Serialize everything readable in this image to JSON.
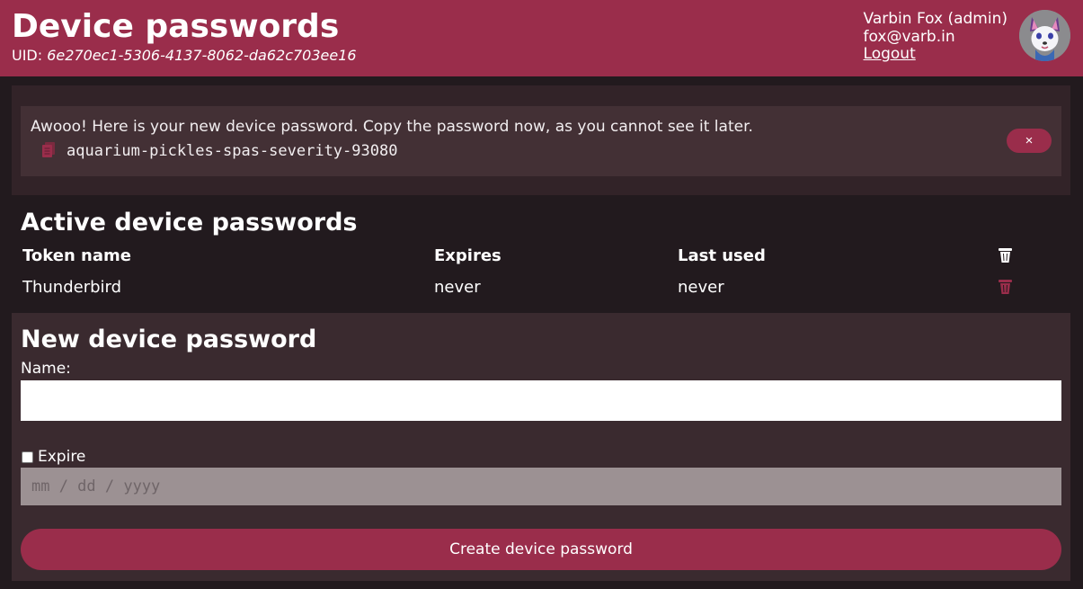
{
  "header": {
    "title": "Device passwords",
    "uid_label": "UID:",
    "uid_value": "6e270ec1-5306-4137-8062-da62c703ee16",
    "user_name": "Varbin Fox (admin)",
    "user_email": "fox@varb.in",
    "logout_label": "Logout"
  },
  "alert": {
    "message": "Awooo! Here is your new device password. Copy the password now, as you cannot see it later.",
    "password": "aquarium-pickles-spas-severity-93080",
    "copy_icon": "copy-icon",
    "close_label": "×"
  },
  "active": {
    "title": "Active device passwords",
    "columns": [
      "Token name",
      "Expires",
      "Last used"
    ],
    "header_icon": "trash-icon",
    "rows": [
      {
        "name": "Thunderbird",
        "expires": "never",
        "last_used": "never",
        "delete_icon": "trash-icon"
      }
    ]
  },
  "form": {
    "title": "New device password",
    "name_label": "Name:",
    "name_value": "",
    "expire_label": "Expire",
    "expire_checked": false,
    "date_placeholder": "mm / dd / yyyy",
    "submit_label": "Create device password"
  },
  "colors": {
    "accent": "#9a2d4b",
    "background": "#221a1e",
    "panel": "#3a2a2f",
    "alert": "#433035"
  }
}
